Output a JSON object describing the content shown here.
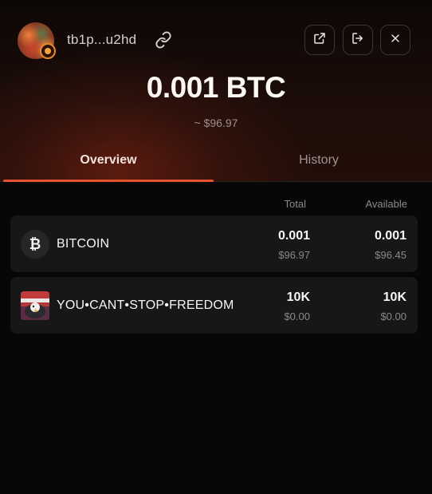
{
  "header": {
    "address": "tb1p...u2hd",
    "icons": {
      "avatar": "inscription-avatar",
      "link": "link-icon",
      "open": "external-link-icon",
      "logout": "logout-icon",
      "close": "close-icon"
    }
  },
  "balance": {
    "amount": "0.001 BTC",
    "usd": "~ $96.97"
  },
  "tabs": [
    {
      "label": "Overview",
      "active": true
    },
    {
      "label": "History",
      "active": false
    }
  ],
  "columns": {
    "total": "Total",
    "available": "Available"
  },
  "assets": [
    {
      "name": "BITCOIN",
      "icon": "bitcoin-icon",
      "icon_glyph": "₿",
      "total": "0.001",
      "total_usd": "$96.97",
      "available": "0.001",
      "available_usd": "$96.45"
    },
    {
      "name": "YOU•CANT•STOP•FREEDOM",
      "icon": "rune-eagle-icon",
      "total": "10K",
      "total_usd": "$0.00",
      "available": "10K",
      "available_usd": "$0.00"
    }
  ],
  "colors": {
    "accent": "#e5532f",
    "background": "#070707",
    "row_bg": "#171717"
  }
}
